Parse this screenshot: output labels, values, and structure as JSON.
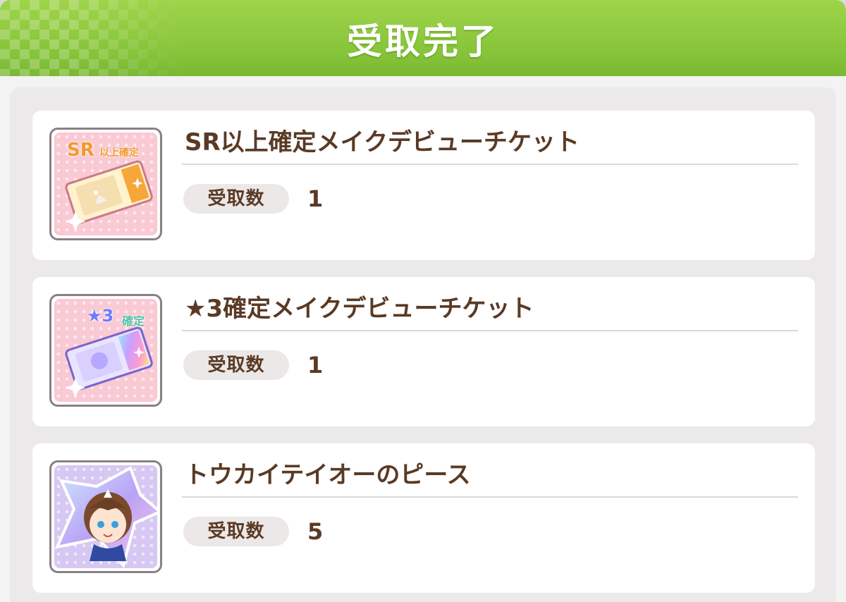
{
  "header": {
    "title": "受取完了"
  },
  "items": [
    {
      "name": "SR以上確定メイクデビューチケット",
      "qty_label": "受取数",
      "qty": "1",
      "icon": "sr-ticket-icon",
      "icon_badge_main": "SR",
      "icon_badge_sub": "以上確定"
    },
    {
      "name": "★3確定メイクデビューチケット",
      "qty_label": "受取数",
      "qty": "1",
      "icon": "star3-ticket-icon",
      "icon_badge_main": "★3",
      "icon_badge_sub": "確定"
    },
    {
      "name": "トウカイテイオーのピース",
      "qty_label": "受取数",
      "qty": "5",
      "icon": "character-piece-icon"
    }
  ],
  "colors": {
    "header_green": "#86c43a",
    "text_brown": "#5a3a25",
    "card_bg": "#ffffff",
    "list_bg": "#ebe9e9"
  }
}
